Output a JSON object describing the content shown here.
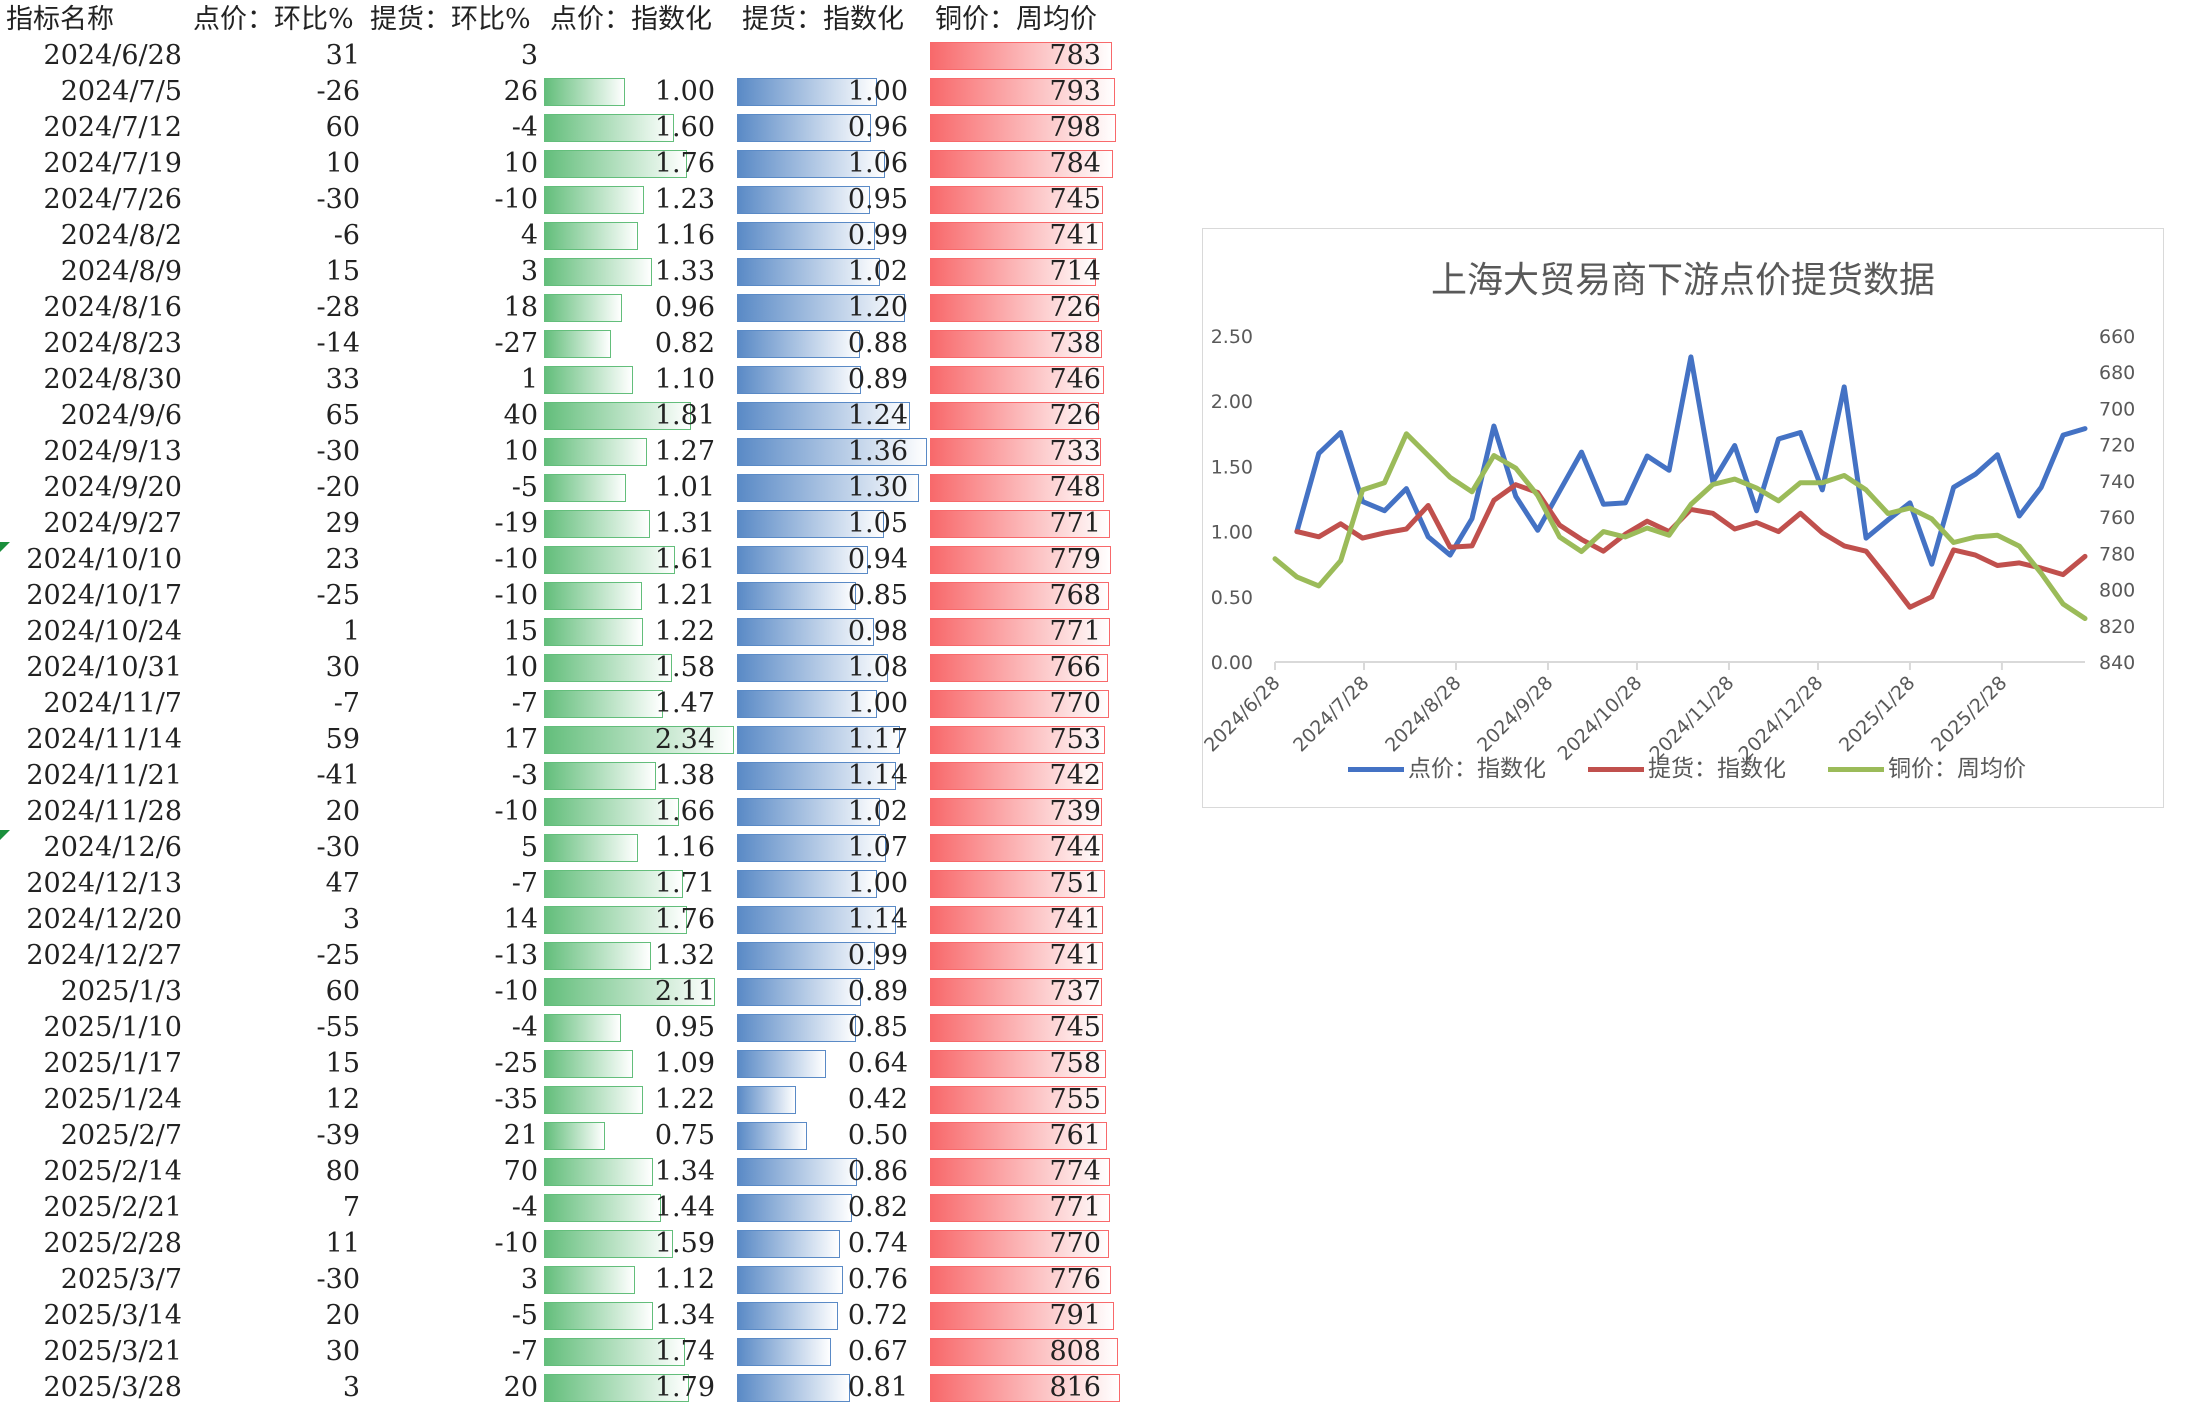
{
  "headers": [
    "指标名称",
    "点价：环比%",
    "提货：环比%",
    "点价：指数化",
    "提货：指数化",
    "铜价：周均价"
  ],
  "rows": [
    {
      "date": "2024/6/28",
      "a": "31",
      "b": "3",
      "d": null,
      "e": null,
      "f": 783
    },
    {
      "date": "2024/7/5",
      "a": "-26",
      "b": "26",
      "d": "1.00",
      "e": "1.00",
      "f": 793
    },
    {
      "date": "2024/7/12",
      "a": "60",
      "b": "-4",
      "d": "1.60",
      "e": "0.96",
      "f": 798
    },
    {
      "date": "2024/7/19",
      "a": "10",
      "b": "10",
      "d": "1.76",
      "e": "1.06",
      "f": 784
    },
    {
      "date": "2024/7/26",
      "a": "-30",
      "b": "-10",
      "d": "1.23",
      "e": "0.95",
      "f": 745
    },
    {
      "date": "2024/8/2",
      "a": "-6",
      "b": "4",
      "d": "1.16",
      "e": "0.99",
      "f": 741
    },
    {
      "date": "2024/8/9",
      "a": "15",
      "b": "3",
      "d": "1.33",
      "e": "1.02",
      "f": 714
    },
    {
      "date": "2024/8/16",
      "a": "-28",
      "b": "18",
      "d": "0.96",
      "e": "1.20",
      "f": 726
    },
    {
      "date": "2024/8/23",
      "a": "-14",
      "b": "-27",
      "d": "0.82",
      "e": "0.88",
      "f": 738
    },
    {
      "date": "2024/8/30",
      "a": "33",
      "b": "1",
      "d": "1.10",
      "e": "0.89",
      "f": 746
    },
    {
      "date": "2024/9/6",
      "a": "65",
      "b": "40",
      "d": "1.81",
      "e": "1.24",
      "f": 726
    },
    {
      "date": "2024/9/13",
      "a": "-30",
      "b": "10",
      "d": "1.27",
      "e": "1.36",
      "f": 733
    },
    {
      "date": "2024/9/20",
      "a": "-20",
      "b": "-5",
      "d": "1.01",
      "e": "1.30",
      "f": 748
    },
    {
      "date": "2024/9/27",
      "a": "29",
      "b": "-19",
      "d": "1.31",
      "e": "1.05",
      "f": 771
    },
    {
      "date": "2024/10/10",
      "a": "23",
      "b": "-10",
      "d": "1.61",
      "e": "0.94",
      "f": 779
    },
    {
      "date": "2024/10/17",
      "a": "-25",
      "b": "-10",
      "d": "1.21",
      "e": "0.85",
      "f": 768
    },
    {
      "date": "2024/10/24",
      "a": "1",
      "b": "15",
      "d": "1.22",
      "e": "0.98",
      "f": 771
    },
    {
      "date": "2024/10/31",
      "a": "30",
      "b": "10",
      "d": "1.58",
      "e": "1.08",
      "f": 766
    },
    {
      "date": "2024/11/7",
      "a": "-7",
      "b": "-7",
      "d": "1.47",
      "e": "1.00",
      "f": 770
    },
    {
      "date": "2024/11/14",
      "a": "59",
      "b": "17",
      "d": "2.34",
      "e": "1.17",
      "f": 753
    },
    {
      "date": "2024/11/21",
      "a": "-41",
      "b": "-3",
      "d": "1.38",
      "e": "1.14",
      "f": 742
    },
    {
      "date": "2024/11/28",
      "a": "20",
      "b": "-10",
      "d": "1.66",
      "e": "1.02",
      "f": 739
    },
    {
      "date": "2024/12/6",
      "a": "-30",
      "b": "5",
      "d": "1.16",
      "e": "1.07",
      "f": 744
    },
    {
      "date": "2024/12/13",
      "a": "47",
      "b": "-7",
      "d": "1.71",
      "e": "1.00",
      "f": 751
    },
    {
      "date": "2024/12/20",
      "a": "3",
      "b": "14",
      "d": "1.76",
      "e": "1.14",
      "f": 741
    },
    {
      "date": "2024/12/27",
      "a": "-25",
      "b": "-13",
      "d": "1.32",
      "e": "0.99",
      "f": 741
    },
    {
      "date": "2025/1/3",
      "a": "60",
      "b": "-10",
      "d": "2.11",
      "e": "0.89",
      "f": 737
    },
    {
      "date": "2025/1/10",
      "a": "-55",
      "b": "-4",
      "d": "0.95",
      "e": "0.85",
      "f": 745
    },
    {
      "date": "2025/1/17",
      "a": "15",
      "b": "-25",
      "d": "1.09",
      "e": "0.64",
      "f": 758
    },
    {
      "date": "2025/1/24",
      "a": "12",
      "b": "-35",
      "d": "1.22",
      "e": "0.42",
      "f": 755
    },
    {
      "date": "2025/2/7",
      "a": "-39",
      "b": "21",
      "d": "0.75",
      "e": "0.50",
      "f": 761
    },
    {
      "date": "2025/2/14",
      "a": "80",
      "b": "70",
      "d": "1.34",
      "e": "0.86",
      "f": 774
    },
    {
      "date": "2025/2/21",
      "a": "7",
      "b": "-4",
      "d": "1.44",
      "e": "0.82",
      "f": 771
    },
    {
      "date": "2025/2/28",
      "a": "11",
      "b": "-10",
      "d": "1.59",
      "e": "0.74",
      "f": 770
    },
    {
      "date": "2025/3/7",
      "a": "-30",
      "b": "3",
      "d": "1.12",
      "e": "0.76",
      "f": 776
    },
    {
      "date": "2025/3/14",
      "a": "20",
      "b": "-5",
      "d": "1.34",
      "e": "0.72",
      "f": 791
    },
    {
      "date": "2025/3/21",
      "a": "30",
      "b": "-7",
      "d": "1.74",
      "e": "0.67",
      "f": 808
    },
    {
      "date": "2025/3/28",
      "a": "3",
      "b": "20",
      "d": "1.79",
      "e": "0.81",
      "f": 816
    }
  ],
  "flagged_rows": [
    "2024/10/10",
    "2024/12/6"
  ],
  "colors": {
    "green_bar": "#63be7b",
    "blue_bar": "#5a8ac6",
    "red_bar": "#f8696b"
  },
  "chart_data": {
    "type": "line",
    "title": "上海大贸易商下游点价提货数据",
    "x": [
      "2024/6/28",
      "2024/7/5",
      "2024/7/12",
      "2024/7/19",
      "2024/7/26",
      "2024/8/2",
      "2024/8/9",
      "2024/8/16",
      "2024/8/23",
      "2024/8/30",
      "2024/9/6",
      "2024/9/13",
      "2024/9/20",
      "2024/9/27",
      "2024/10/10",
      "2024/10/17",
      "2024/10/24",
      "2024/10/31",
      "2024/11/7",
      "2024/11/14",
      "2024/11/21",
      "2024/11/28",
      "2024/12/6",
      "2024/12/13",
      "2024/12/20",
      "2024/12/27",
      "2025/1/3",
      "2025/1/10",
      "2025/1/17",
      "2025/1/24",
      "2025/2/7",
      "2025/2/14",
      "2025/2/21",
      "2025/2/28",
      "2025/3/7",
      "2025/3/14",
      "2025/3/21",
      "2025/3/28"
    ],
    "xticks": [
      "2024/6/28",
      "2024/7/28",
      "2024/8/28",
      "2024/9/28",
      "2024/10/28",
      "2024/11/28",
      "2024/12/28",
      "2025/1/28",
      "2025/2/28"
    ],
    "series": [
      {
        "name": "点价：指数化",
        "color": "#4472c4",
        "axis": "left",
        "values": [
          null,
          1.0,
          1.6,
          1.76,
          1.23,
          1.16,
          1.33,
          0.96,
          0.82,
          1.1,
          1.81,
          1.27,
          1.01,
          1.31,
          1.61,
          1.21,
          1.22,
          1.58,
          1.47,
          2.34,
          1.38,
          1.66,
          1.16,
          1.71,
          1.76,
          1.32,
          2.11,
          0.95,
          1.09,
          1.22,
          0.75,
          1.34,
          1.44,
          1.59,
          1.12,
          1.34,
          1.74,
          1.79
        ]
      },
      {
        "name": "提货：指数化",
        "color": "#c0504d",
        "axis": "left",
        "values": [
          null,
          1.0,
          0.96,
          1.06,
          0.95,
          0.99,
          1.02,
          1.2,
          0.88,
          0.89,
          1.24,
          1.36,
          1.3,
          1.05,
          0.94,
          0.85,
          0.98,
          1.08,
          1.0,
          1.17,
          1.14,
          1.02,
          1.07,
          1.0,
          1.14,
          0.99,
          0.89,
          0.85,
          0.64,
          0.42,
          0.5,
          0.86,
          0.82,
          0.74,
          0.76,
          0.72,
          0.67,
          0.81
        ]
      },
      {
        "name": "铜价：周均价",
        "color": "#9bbb59",
        "axis": "right",
        "values": [
          783,
          793,
          798,
          784,
          745,
          741,
          714,
          726,
          738,
          746,
          726,
          733,
          748,
          771,
          779,
          768,
          771,
          766,
          770,
          753,
          742,
          739,
          744,
          751,
          741,
          741,
          737,
          745,
          758,
          755,
          761,
          774,
          771,
          770,
          776,
          791,
          808,
          816
        ]
      }
    ],
    "left_axis": {
      "min": 0,
      "max": 2.5,
      "ticks": [
        "0.00",
        "0.50",
        "1.00",
        "1.50",
        "2.00",
        "2.50"
      ]
    },
    "right_axis": {
      "min": 660,
      "max": 840,
      "reversed": true,
      "ticks": [
        "660",
        "680",
        "700",
        "720",
        "740",
        "760",
        "780",
        "800",
        "820",
        "840"
      ]
    },
    "grid": false,
    "legend": "bottom"
  }
}
